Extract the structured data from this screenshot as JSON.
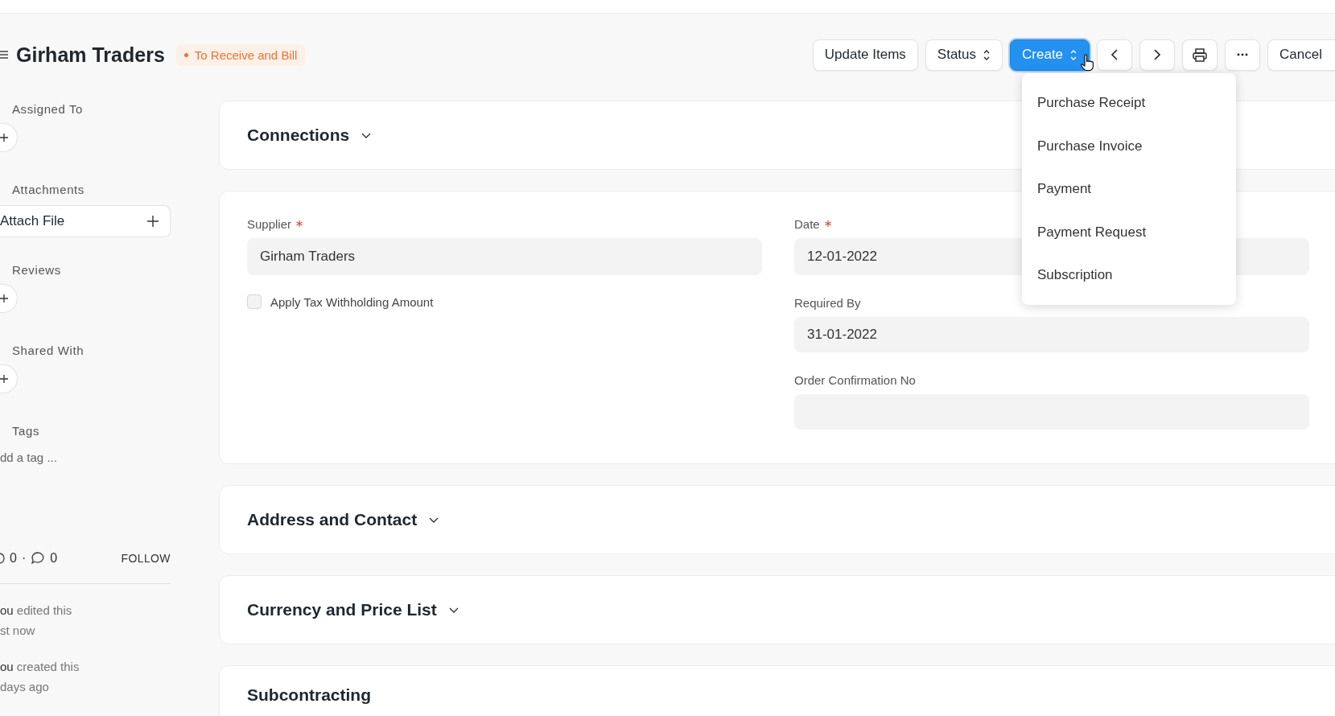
{
  "header": {
    "title": "Girham Traders",
    "status": "To Receive and Bill"
  },
  "actions": [
    {
      "kind": "button",
      "label": "Update Items"
    },
    {
      "kind": "select",
      "label": "Status"
    },
    {
      "kind": "primary",
      "label": "Create"
    },
    {
      "kind": "prev"
    },
    {
      "kind": "next"
    },
    {
      "kind": "print"
    },
    {
      "kind": "more"
    },
    {
      "kind": "button",
      "label": "Cancel"
    }
  ],
  "create_menu": {
    "items": [
      "Purchase Receipt",
      "Purchase Invoice",
      "Payment",
      "Payment Request",
      "Subscription"
    ]
  },
  "sidebar": {
    "sections": [
      {
        "kind": "add",
        "heading": "Assigned To"
      },
      {
        "kind": "attach",
        "heading": "Attachments",
        "button": "Attach File"
      },
      {
        "kind": "add",
        "heading": "Reviews"
      },
      {
        "kind": "add",
        "heading": "Shared With"
      },
      {
        "kind": "tags",
        "heading": "Tags",
        "placeholder": "dd a tag ..."
      }
    ],
    "likes": "0",
    "separator": "·",
    "comments": "0",
    "follow": "FOLLOW",
    "activity": [
      {
        "text": "**ou** edited this",
        "time": "st now"
      },
      {
        "text": "**ou** created this",
        "time": "days ago"
      }
    ]
  },
  "sections": [
    {
      "kind": "collapsible",
      "title": "Connections",
      "expanded": false
    },
    {
      "kind": "form",
      "left": [
        {
          "kind": "field",
          "label": "Supplier",
          "required": true,
          "value": "Girham Traders"
        },
        {
          "kind": "checkbox",
          "label": "Apply Tax Withholding Amount",
          "checked": false
        }
      ],
      "right": [
        {
          "kind": "field",
          "label": "Date",
          "required": true,
          "value": "12-01-2022"
        },
        {
          "kind": "field",
          "label": "Required By",
          "required": false,
          "value": "31-01-2022"
        },
        {
          "kind": "field",
          "label": "Order Confirmation No",
          "required": false
        }
      ]
    },
    {
      "kind": "collapsible",
      "title": "Address and Contact",
      "expanded": false
    },
    {
      "kind": "collapsible",
      "title": "Currency and Price List",
      "expanded": false
    },
    {
      "kind": "plain",
      "title": "Subcontracting"
    }
  ]
}
